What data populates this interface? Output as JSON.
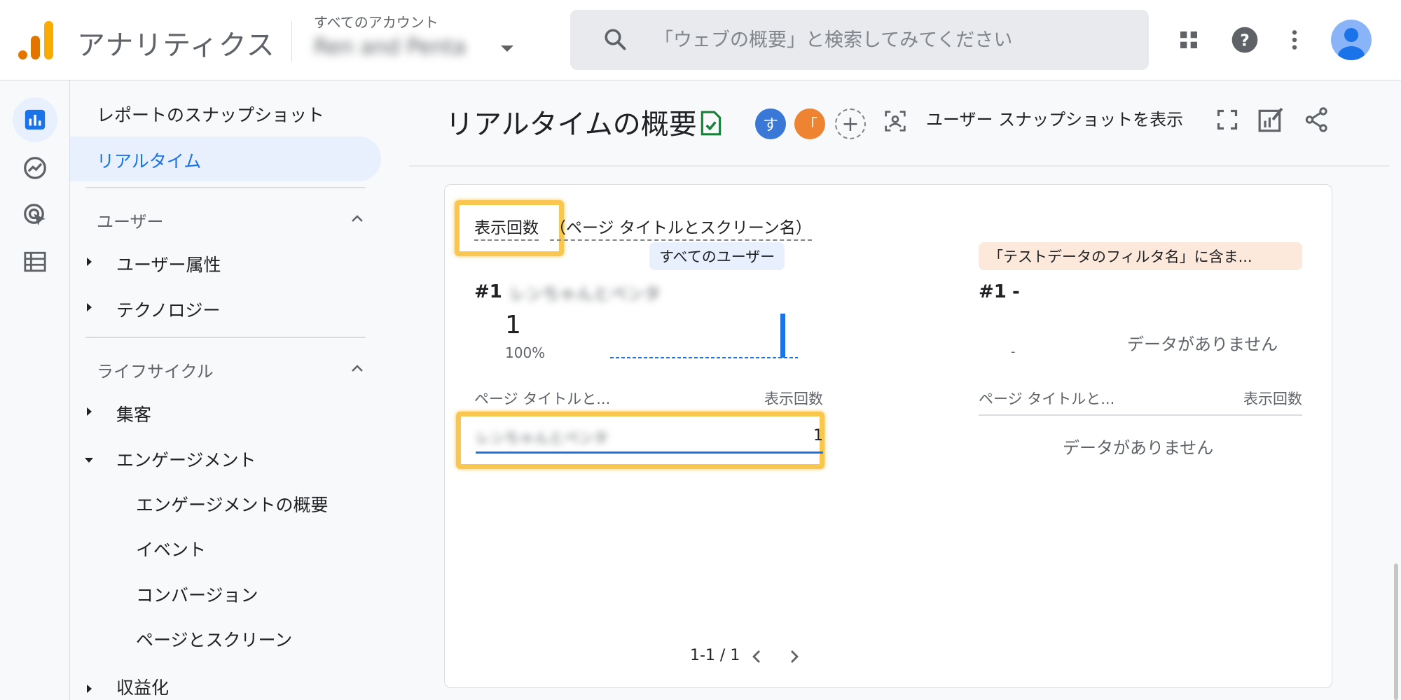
{
  "header": {
    "app_title": "アナリティクス",
    "account_label": "すべてのアカウント",
    "account_name": "Ren and Penta",
    "search_placeholder": "「ウェブの概要」と検索してみてください"
  },
  "icons": {
    "logo": "analytics-logo",
    "search": "search-icon",
    "apps": "apps-grid-icon",
    "help": "help-icon",
    "more": "more-vert-icon",
    "avatar": "account-avatar",
    "rail": [
      "reports-icon",
      "explore-icon",
      "advertising-icon",
      "configure-icon"
    ]
  },
  "sidebar": {
    "snapshot": "レポートのスナップショット",
    "realtime": "リアルタイム",
    "section_user": "ユーザー",
    "user_attributes": "ユーザー属性",
    "technology": "テクノロジー",
    "section_lifecycle": "ライフサイクル",
    "acquisition": "集客",
    "engagement": "エンゲージメント",
    "engagement_overview": "エンゲージメントの概要",
    "events": "イベント",
    "conversions": "コンバージョン",
    "pages_screens": "ページとスクリーン",
    "monetization": "収益化"
  },
  "main": {
    "title": "リアルタイムの概要",
    "cmp_chip_1": "す",
    "cmp_chip_2": "「",
    "add_comparison": "+",
    "user_snapshot": "ユーザー スナップショットを表示"
  },
  "card": {
    "metric": "表示回数",
    "dimension": "（ページ タイトルとスクリーン名）",
    "left": {
      "segment": "すべてのユーザー",
      "rank": "#1",
      "top_item": "レンちゃんとペンタ",
      "value": "1",
      "percent": "100%",
      "col_dim": "ページ タイトルと...",
      "col_metric": "表示回数",
      "row_name": "レンちゃんとペンタ",
      "row_value": "1"
    },
    "right": {
      "segment": "「テストデータのフィルタ名」に含ま...",
      "rank": "#1",
      "rank_dash": "-",
      "small_dash": "-",
      "no_data_top": "データがありません",
      "col_dim": "ページ タイトルと...",
      "col_metric": "表示回数",
      "no_data_table": "データがありません"
    },
    "pager": "1-1 / 1"
  },
  "colors": {
    "accent_blue": "#1a73e8",
    "highlight": "#f9c74f",
    "chip_blue": "#3a78d8",
    "chip_orange": "#ee8432",
    "logo_orange": "#f9ab00",
    "logo_dark_orange": "#e37400"
  }
}
